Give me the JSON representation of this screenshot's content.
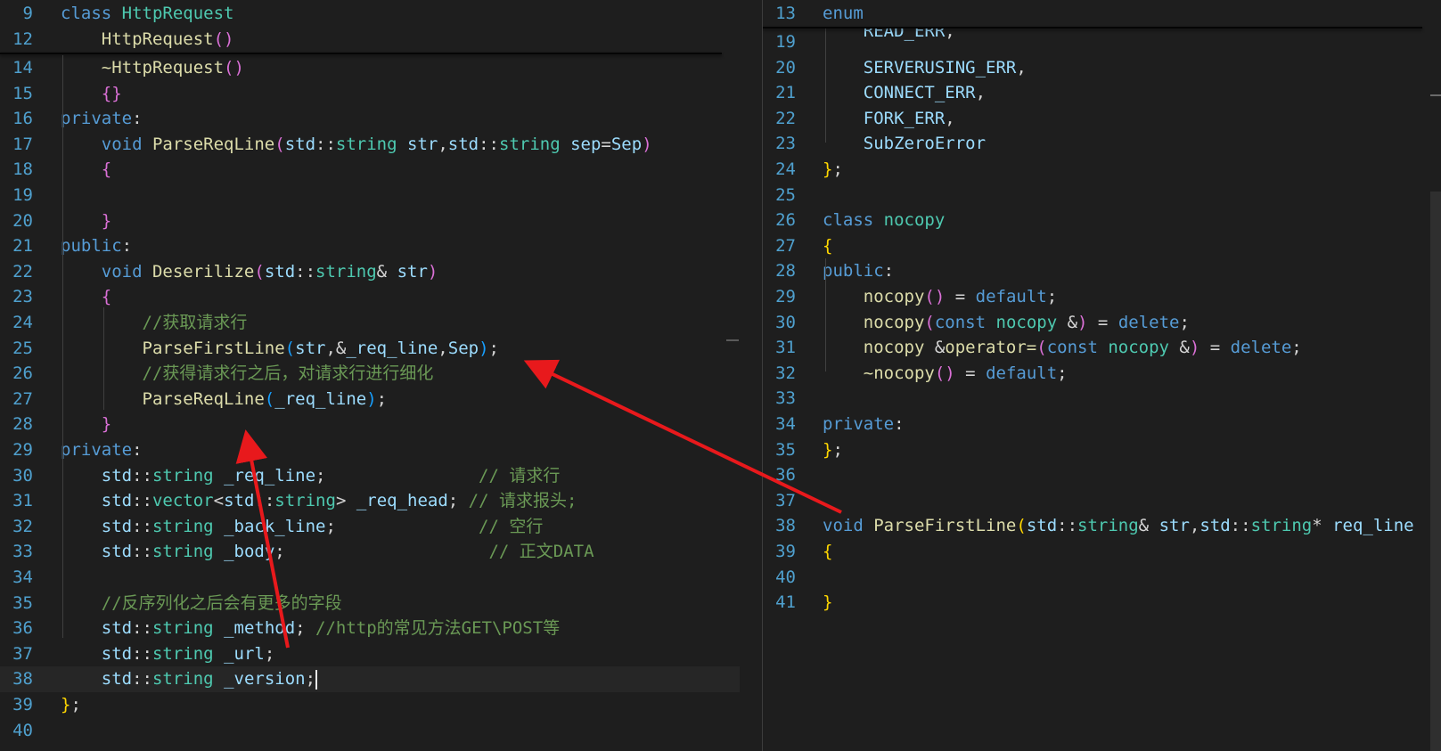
{
  "left_editor": {
    "sticky": [
      {
        "num": "9",
        "tokens": [
          [
            "kw",
            "class "
          ],
          [
            "ty",
            "HttpRequest"
          ]
        ]
      },
      {
        "num": "12",
        "tokens": [
          [
            "tx",
            "    "
          ],
          [
            "fn",
            "HttpRequest"
          ],
          [
            "p2",
            "()"
          ]
        ]
      }
    ],
    "lines": [
      {
        "num": "14",
        "tokens": [
          [
            "tx",
            "    "
          ],
          [
            "fn",
            "~HttpRequest"
          ],
          [
            "p2",
            "()"
          ]
        ]
      },
      {
        "num": "15",
        "tokens": [
          [
            "tx",
            "    "
          ],
          [
            "p2",
            "{}"
          ]
        ]
      },
      {
        "num": "16",
        "tokens": [
          [
            "kw",
            "private"
          ],
          [
            "tx",
            ":"
          ]
        ]
      },
      {
        "num": "17",
        "tokens": [
          [
            "tx",
            "    "
          ],
          [
            "kw",
            "void "
          ],
          [
            "fn",
            "ParseReqLine"
          ],
          [
            "p2",
            "("
          ],
          [
            "pm",
            "std"
          ],
          [
            "tx",
            "::"
          ],
          [
            "ty",
            "string "
          ],
          [
            "pm",
            "str"
          ],
          [
            "tx",
            ","
          ],
          [
            "pm",
            "std"
          ],
          [
            "tx",
            "::"
          ],
          [
            "ty",
            "string "
          ],
          [
            "pm",
            "sep"
          ],
          [
            "tx",
            "="
          ],
          [
            "pm",
            "Sep"
          ],
          [
            "p2",
            ")"
          ]
        ]
      },
      {
        "num": "18",
        "tokens": [
          [
            "tx",
            "    "
          ],
          [
            "p2",
            "{"
          ]
        ]
      },
      {
        "num": "19",
        "tokens": []
      },
      {
        "num": "20",
        "tokens": [
          [
            "tx",
            "    "
          ],
          [
            "p2",
            "}"
          ]
        ]
      },
      {
        "num": "21",
        "tokens": [
          [
            "kw",
            "public"
          ],
          [
            "tx",
            ":"
          ]
        ]
      },
      {
        "num": "22",
        "tokens": [
          [
            "tx",
            "    "
          ],
          [
            "kw",
            "void "
          ],
          [
            "fn",
            "Deserilize"
          ],
          [
            "p2",
            "("
          ],
          [
            "pm",
            "std"
          ],
          [
            "tx",
            "::"
          ],
          [
            "ty",
            "string"
          ],
          [
            "tx",
            "& "
          ],
          [
            "pm",
            "str"
          ],
          [
            "p2",
            ")"
          ]
        ]
      },
      {
        "num": "23",
        "tokens": [
          [
            "tx",
            "    "
          ],
          [
            "p2",
            "{"
          ]
        ]
      },
      {
        "num": "24",
        "tokens": [
          [
            "tx",
            "        "
          ],
          [
            "cm",
            "//获取请求行"
          ]
        ]
      },
      {
        "num": "25",
        "tokens": [
          [
            "tx",
            "        "
          ],
          [
            "fn",
            "ParseFirstLine"
          ],
          [
            "p3",
            "("
          ],
          [
            "pm",
            "str"
          ],
          [
            "tx",
            ",&"
          ],
          [
            "pm",
            "_req_line"
          ],
          [
            "tx",
            ","
          ],
          [
            "pm",
            "Sep"
          ],
          [
            "p3",
            ")"
          ],
          [
            "tx",
            ";"
          ]
        ]
      },
      {
        "num": "26",
        "tokens": [
          [
            "tx",
            "        "
          ],
          [
            "cm",
            "//获得请求行之后，对请求行进行细化"
          ]
        ]
      },
      {
        "num": "27",
        "tokens": [
          [
            "tx",
            "        "
          ],
          [
            "fn",
            "ParseReqLine"
          ],
          [
            "p3",
            "("
          ],
          [
            "pm",
            "_req_line"
          ],
          [
            "p3",
            ")"
          ],
          [
            "tx",
            ";"
          ]
        ]
      },
      {
        "num": "28",
        "tokens": [
          [
            "tx",
            "    "
          ],
          [
            "p2",
            "}"
          ]
        ]
      },
      {
        "num": "29",
        "tokens": [
          [
            "kw",
            "private"
          ],
          [
            "tx",
            ":"
          ]
        ]
      },
      {
        "num": "30",
        "tokens": [
          [
            "tx",
            "    "
          ],
          [
            "pm",
            "std"
          ],
          [
            "tx",
            "::"
          ],
          [
            "ty",
            "string "
          ],
          [
            "pm",
            "_req_line"
          ],
          [
            "tx",
            ";               "
          ],
          [
            "cm",
            "// 请求行"
          ]
        ]
      },
      {
        "num": "31",
        "tokens": [
          [
            "tx",
            "    "
          ],
          [
            "pm",
            "std"
          ],
          [
            "tx",
            "::"
          ],
          [
            "ty",
            "vector"
          ],
          [
            "tx",
            "<"
          ],
          [
            "pm",
            "std"
          ],
          [
            "tx",
            "::"
          ],
          [
            "ty",
            "string"
          ],
          [
            "tx",
            "> "
          ],
          [
            "pm",
            "_req_head"
          ],
          [
            "tx",
            "; "
          ],
          [
            "cm",
            "// 请求报头;"
          ]
        ]
      },
      {
        "num": "32",
        "tokens": [
          [
            "tx",
            "    "
          ],
          [
            "pm",
            "std"
          ],
          [
            "tx",
            "::"
          ],
          [
            "ty",
            "string "
          ],
          [
            "pm",
            "_back_line"
          ],
          [
            "tx",
            ";              "
          ],
          [
            "cm",
            "// 空行"
          ]
        ]
      },
      {
        "num": "33",
        "tokens": [
          [
            "tx",
            "    "
          ],
          [
            "pm",
            "std"
          ],
          [
            "tx",
            "::"
          ],
          [
            "ty",
            "string "
          ],
          [
            "pm",
            "_body"
          ],
          [
            "tx",
            ";                    "
          ],
          [
            "cm",
            "// 正文DATA"
          ]
        ]
      },
      {
        "num": "34",
        "tokens": []
      },
      {
        "num": "35",
        "tokens": [
          [
            "tx",
            "    "
          ],
          [
            "cm",
            "//反序列化之后会有更多的字段"
          ]
        ]
      },
      {
        "num": "36",
        "tokens": [
          [
            "tx",
            "    "
          ],
          [
            "pm",
            "std"
          ],
          [
            "tx",
            "::"
          ],
          [
            "ty",
            "string "
          ],
          [
            "pm",
            "_method"
          ],
          [
            "tx",
            "; "
          ],
          [
            "cm",
            "//http的常见方法GET\\POST等"
          ]
        ]
      },
      {
        "num": "37",
        "tokens": [
          [
            "tx",
            "    "
          ],
          [
            "pm",
            "std"
          ],
          [
            "tx",
            "::"
          ],
          [
            "ty",
            "string "
          ],
          [
            "pm",
            "_url"
          ],
          [
            "tx",
            ";"
          ]
        ]
      },
      {
        "num": "38",
        "tokens": [
          [
            "tx",
            "    "
          ],
          [
            "pm",
            "std"
          ],
          [
            "tx",
            "::"
          ],
          [
            "ty",
            "string "
          ],
          [
            "pm",
            "_version"
          ],
          [
            "tx",
            ";"
          ]
        ],
        "caret": true
      },
      {
        "num": "39",
        "tokens": [
          [
            "p1",
            "}"
          ],
          [
            "tx",
            ";"
          ]
        ]
      },
      {
        "num": "40",
        "tokens": []
      }
    ]
  },
  "right_editor": {
    "sticky": [
      {
        "num": "13",
        "tokens": [
          [
            "kw",
            "enum"
          ]
        ]
      }
    ],
    "lines": [
      {
        "num": "19",
        "tokens": [
          [
            "tx",
            "    "
          ],
          [
            "pm",
            "READ_ERR"
          ],
          [
            "tx",
            ","
          ]
        ],
        "partial": true
      },
      {
        "num": "20",
        "tokens": [
          [
            "tx",
            "    "
          ],
          [
            "pm",
            "SERVERUSING_ERR"
          ],
          [
            "tx",
            ","
          ]
        ]
      },
      {
        "num": "21",
        "tokens": [
          [
            "tx",
            "    "
          ],
          [
            "pm",
            "CONNECT_ERR"
          ],
          [
            "tx",
            ","
          ]
        ]
      },
      {
        "num": "22",
        "tokens": [
          [
            "tx",
            "    "
          ],
          [
            "pm",
            "FORK_ERR"
          ],
          [
            "tx",
            ","
          ]
        ]
      },
      {
        "num": "23",
        "tokens": [
          [
            "tx",
            "    "
          ],
          [
            "pm",
            "SubZeroError"
          ]
        ]
      },
      {
        "num": "24",
        "tokens": [
          [
            "p1",
            "}"
          ],
          [
            "tx",
            ";"
          ]
        ]
      },
      {
        "num": "25",
        "tokens": []
      },
      {
        "num": "26",
        "tokens": [
          [
            "kw",
            "class "
          ],
          [
            "ty",
            "nocopy"
          ]
        ]
      },
      {
        "num": "27",
        "tokens": [
          [
            "p1",
            "{"
          ]
        ]
      },
      {
        "num": "28",
        "tokens": [
          [
            "kw",
            "public"
          ],
          [
            "tx",
            ":"
          ]
        ]
      },
      {
        "num": "29",
        "tokens": [
          [
            "tx",
            "    "
          ],
          [
            "fn",
            "nocopy"
          ],
          [
            "p2",
            "()"
          ],
          [
            "tx",
            " = "
          ],
          [
            "kw",
            "default"
          ],
          [
            "tx",
            ";"
          ]
        ]
      },
      {
        "num": "30",
        "tokens": [
          [
            "tx",
            "    "
          ],
          [
            "fn",
            "nocopy"
          ],
          [
            "p2",
            "("
          ],
          [
            "kw",
            "const "
          ],
          [
            "ty",
            "nocopy "
          ],
          [
            "tx",
            "&"
          ],
          [
            "p2",
            ")"
          ],
          [
            "tx",
            " = "
          ],
          [
            "kw",
            "delete"
          ],
          [
            "tx",
            ";"
          ]
        ]
      },
      {
        "num": "31",
        "tokens": [
          [
            "tx",
            "    "
          ],
          [
            "fn",
            "nocopy "
          ],
          [
            "tx",
            "&"
          ],
          [
            "fn",
            "operator="
          ],
          [
            "p2",
            "("
          ],
          [
            "kw",
            "const "
          ],
          [
            "ty",
            "nocopy "
          ],
          [
            "tx",
            "&"
          ],
          [
            "p2",
            ")"
          ],
          [
            "tx",
            " = "
          ],
          [
            "kw",
            "delete"
          ],
          [
            "tx",
            ";"
          ]
        ]
      },
      {
        "num": "32",
        "tokens": [
          [
            "tx",
            "    "
          ],
          [
            "fn",
            "~nocopy"
          ],
          [
            "p2",
            "()"
          ],
          [
            "tx",
            " = "
          ],
          [
            "kw",
            "default"
          ],
          [
            "tx",
            ";"
          ]
        ]
      },
      {
        "num": "33",
        "tokens": []
      },
      {
        "num": "34",
        "tokens": [
          [
            "kw",
            "private"
          ],
          [
            "tx",
            ":"
          ]
        ]
      },
      {
        "num": "35",
        "tokens": [
          [
            "p1",
            "}"
          ],
          [
            "tx",
            ";"
          ]
        ]
      },
      {
        "num": "36",
        "tokens": []
      },
      {
        "num": "37",
        "tokens": []
      },
      {
        "num": "38",
        "tokens": [
          [
            "kw",
            "void "
          ],
          [
            "fn",
            "ParseFirstLine"
          ],
          [
            "p1",
            "("
          ],
          [
            "pm",
            "std"
          ],
          [
            "tx",
            "::"
          ],
          [
            "ty",
            "string"
          ],
          [
            "tx",
            "& "
          ],
          [
            "pm",
            "str"
          ],
          [
            "tx",
            ","
          ],
          [
            "pm",
            "std"
          ],
          [
            "tx",
            "::"
          ],
          [
            "ty",
            "string"
          ],
          [
            "tx",
            "* "
          ],
          [
            "pm",
            "req_line"
          ]
        ]
      },
      {
        "num": "39",
        "tokens": [
          [
            "p1",
            "{"
          ]
        ]
      },
      {
        "num": "40",
        "tokens": []
      },
      {
        "num": "41",
        "tokens": [
          [
            "p1",
            "}"
          ]
        ]
      }
    ]
  },
  "annotations": {
    "arrow_color": "#e8191c"
  }
}
